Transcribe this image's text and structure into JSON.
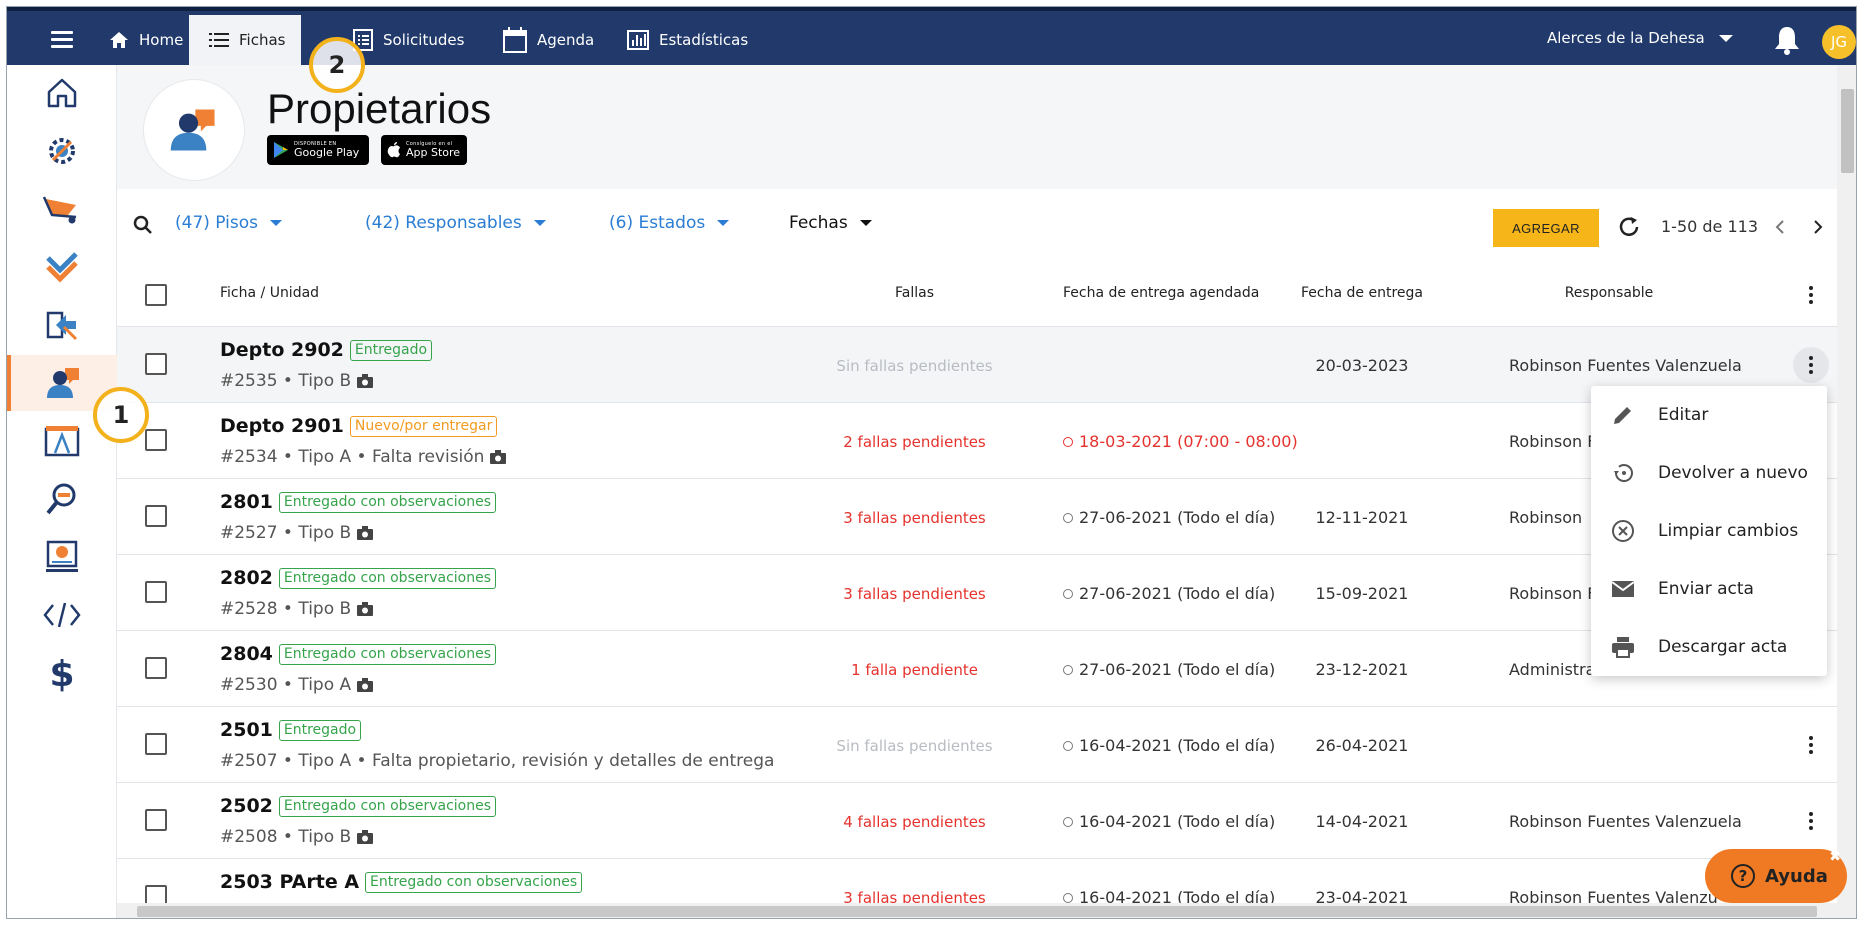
{
  "nav": {
    "items": [
      {
        "label": "Home",
        "icon": "home-icon"
      },
      {
        "label": "Fichas",
        "icon": "list-icon"
      },
      {
        "label": "Solicitudes",
        "icon": "form-icon"
      },
      {
        "label": "Agenda",
        "icon": "calendar-icon"
      },
      {
        "label": "Estadísticas",
        "icon": "bar-chart-icon"
      }
    ],
    "active": "Fichas",
    "organization": "Alerces de la Dehesa",
    "user_initials": "JG",
    "colors": {
      "bar": "#213a6b",
      "avatar": "#f6c02b",
      "accent": "#f08033"
    }
  },
  "sidebar": {
    "items": [
      "home-outline-icon",
      "gear-tools-icon",
      "wheelbarrow-icon",
      "check-layers-icon",
      "handover-icon",
      "owners-icon",
      "blueprint-icon",
      "inspect-icon",
      "certificate-icon",
      "code-icon",
      "dollar-icon"
    ],
    "active_index": 5
  },
  "header": {
    "title": "Propietarios",
    "google_play": {
      "small": "DISPONIBLE EN",
      "big": "Google Play"
    },
    "app_store": {
      "small": "Consíguelo en el",
      "big": "App Store"
    }
  },
  "filters": {
    "pisos": "(47) Pisos",
    "responsables": "(42) Responsables",
    "estados": "(6) Estados",
    "fechas": "Fechas",
    "add_label": "AGREGAR",
    "pagination": "1-50 de 113"
  },
  "table": {
    "headers": {
      "unit": "Ficha / Unidad",
      "fallas": "Fallas",
      "agendada": "Fecha de entrega agendada",
      "entrega": "Fecha de entrega",
      "responsable": "Responsable"
    },
    "rows": [
      {
        "unit": "Depto 2902",
        "status": "Entregado",
        "status_color": "green",
        "sub": "#2535 • Tipo B",
        "camera": true,
        "fallas": "Sin fallas pendientes",
        "fallas_type": "none",
        "agendada": "",
        "entrega": "20-03-2023",
        "responsable": "Robinson Fuentes Valenzuela"
      },
      {
        "unit": "Depto 2901",
        "status": "Nuevo/por entregar",
        "status_color": "orange",
        "sub": "#2534 • Tipo A • Falta revisión",
        "camera": true,
        "fallas": "2 fallas pendientes",
        "fallas_type": "red",
        "agendada": "18-03-2021 (07:00 - 08:00)",
        "agendada_red": true,
        "entrega": "",
        "responsable": "Robinson F"
      },
      {
        "unit": "2801",
        "status": "Entregado con observaciones",
        "status_color": "green",
        "sub": "#2527 • Tipo B",
        "camera": true,
        "fallas": "3 fallas pendientes",
        "fallas_type": "red",
        "agendada": "27-06-2021 (Todo el día)",
        "entrega": "12-11-2021",
        "responsable": "Robinson"
      },
      {
        "unit": "2802",
        "status": "Entregado con observaciones",
        "status_color": "green",
        "sub": "#2528 • Tipo B",
        "camera": true,
        "fallas": "3 fallas pendientes",
        "fallas_type": "red",
        "agendada": "27-06-2021 (Todo el día)",
        "entrega": "15-09-2021",
        "responsable": "Robinson F"
      },
      {
        "unit": "2804",
        "status": "Entregado con observaciones",
        "status_color": "green",
        "sub": "#2530 • Tipo A",
        "camera": true,
        "fallas": "1 falla pendiente",
        "fallas_type": "red",
        "agendada": "27-06-2021 (Todo el día)",
        "entrega": "23-12-2021",
        "responsable": "Administra"
      },
      {
        "unit": "2501",
        "status": "Entregado",
        "status_color": "green",
        "sub": "#2507 • Tipo A • Falta propietario, revisión y detalles de entrega",
        "camera": false,
        "fallas": "Sin fallas pendientes",
        "fallas_type": "none",
        "agendada": "16-04-2021 (Todo el día)",
        "entrega": "26-04-2021",
        "responsable": ""
      },
      {
        "unit": "2502",
        "status": "Entregado con observaciones",
        "status_color": "green",
        "sub": "#2508 • Tipo B",
        "camera": true,
        "fallas": "4 fallas pendientes",
        "fallas_type": "red",
        "agendada": "16-04-2021 (Todo el día)",
        "entrega": "14-04-2021",
        "responsable": "Robinson Fuentes Valenzuela"
      },
      {
        "unit": "2503 PArte A",
        "status": "Entregado con observaciones",
        "status_color": "green",
        "sub": "",
        "camera": false,
        "fallas": "3 fallas pendientes",
        "fallas_type": "red",
        "agendada": "16-04-2021 (Todo el día)",
        "entrega": "23-04-2021",
        "responsable": "Robinson Fuentes Valenzu"
      }
    ]
  },
  "context_menu": {
    "items": [
      {
        "label": "Editar",
        "icon": "pencil-icon"
      },
      {
        "label": "Devolver a nuevo",
        "icon": "restore-icon"
      },
      {
        "label": "Limpiar cambios",
        "icon": "clear-circle-icon"
      },
      {
        "label": "Enviar acta",
        "icon": "mail-icon"
      },
      {
        "label": "Descargar acta",
        "icon": "print-icon"
      }
    ]
  },
  "callouts": [
    "1",
    "2"
  ],
  "help": {
    "label": "Ayuda",
    "close": "✖"
  }
}
